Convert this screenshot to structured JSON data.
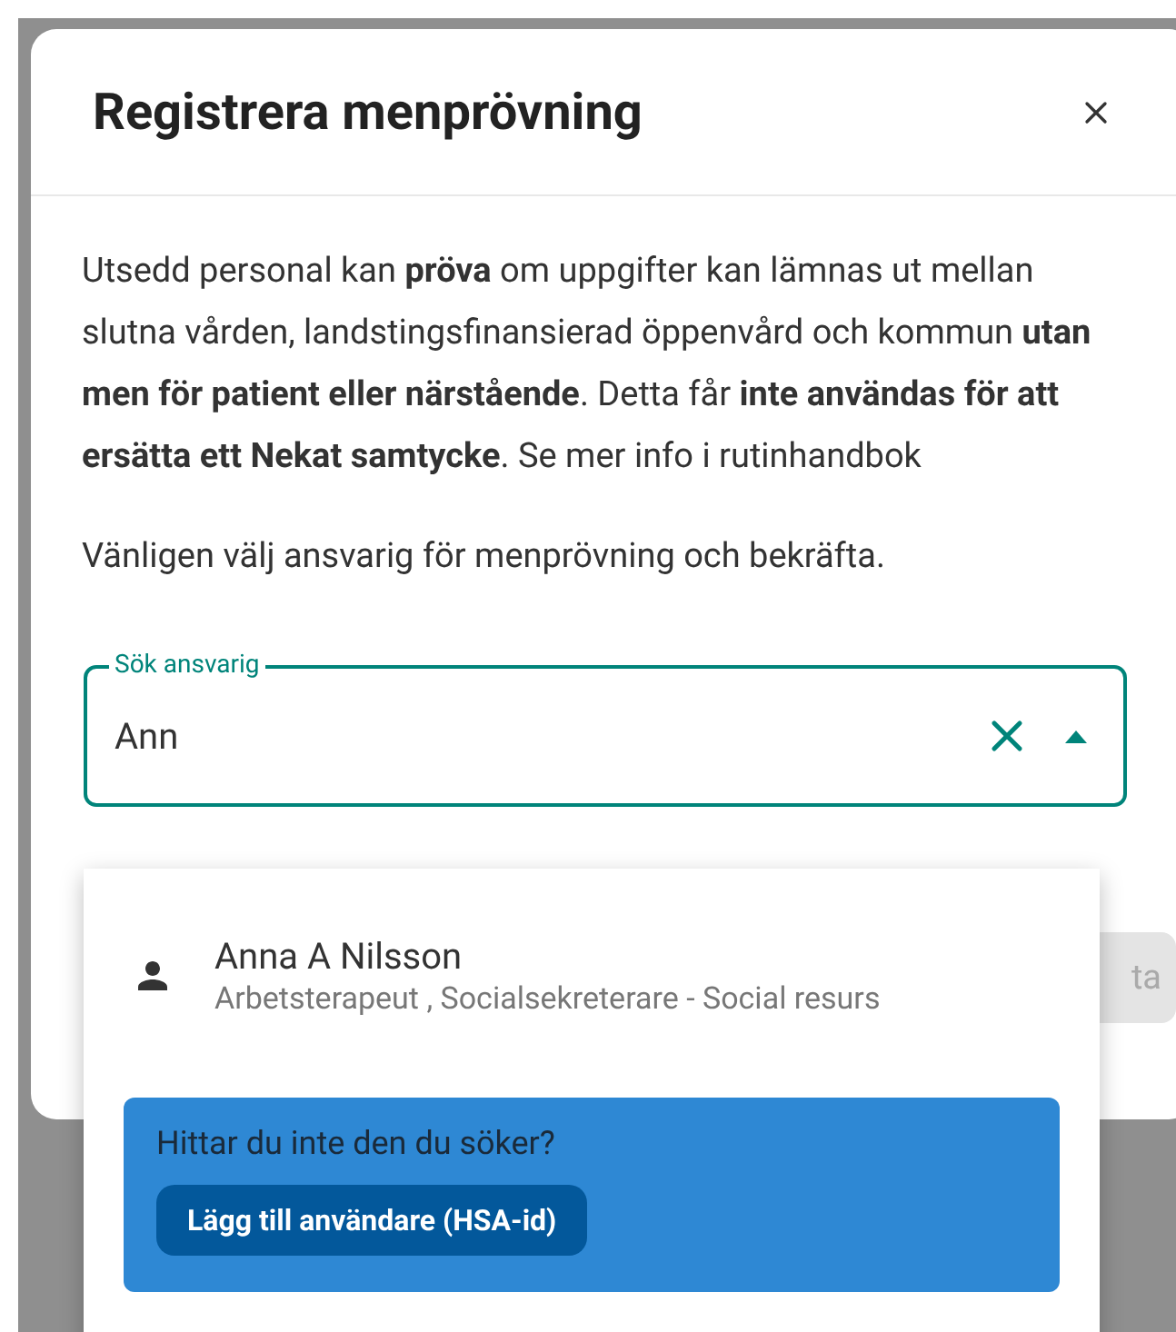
{
  "dialog": {
    "title": "Registrera menprövning",
    "paragraphs": [
      "Utsedd personal kan **pröva** om uppgifter kan lämnas ut mellan slutna vården, landstingsfinansierad öppenvård och kommun **utan men för patient eller närstående**. Detta får **inte användas för att ersätta ett Nekat samtycke**. Se mer info i rutinhandbok",
      "Vänligen välj ansvarig för menprövning och bekräfta."
    ],
    "search_field": {
      "label": "Sök ansvarig",
      "value": "Ann",
      "expanded": true
    },
    "footer_button": {
      "label": "ta",
      "disabled": true
    }
  },
  "dropdown": {
    "options": [
      {
        "name": "Anna A Nilsson",
        "subtitle": "Arbetsterapeut , Socialsekreterare - Social resurs"
      }
    ],
    "not_found": {
      "text": "Hittar du inte den du söker?",
      "button": "Lägg till användare (HSA-id)"
    }
  }
}
